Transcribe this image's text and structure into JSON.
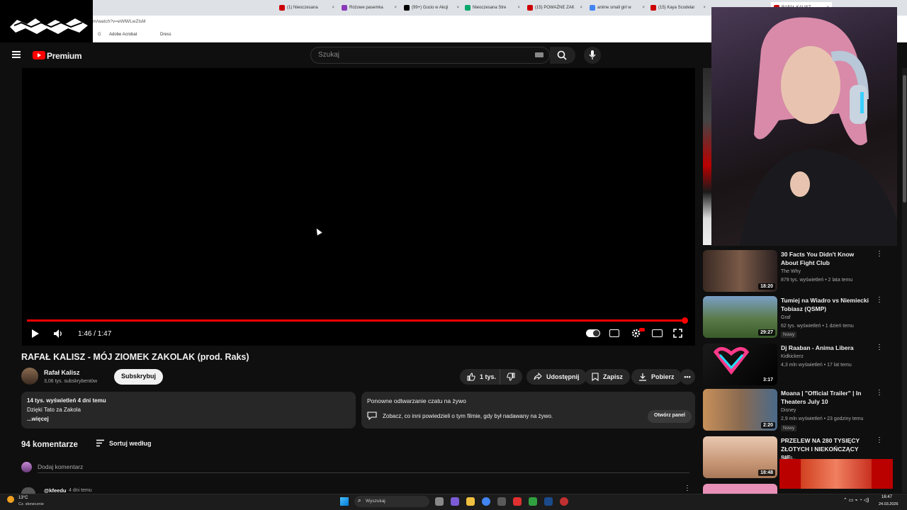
{
  "browser": {
    "tabs": [
      "(1) Nieoczesana",
      "Różowe pasemka",
      "(99+) Gucio w Akcji",
      "Nieoczesana Stre",
      "(15) POWAŻNE ZAK",
      "anime small girl w",
      "(15) Kaya Scodelar",
      "RAFAŁ KALISZ"
    ],
    "url": "m/watch?v=eWlWLwZlsM",
    "bookmarks": [
      "Adobe Acrobat",
      "Dress"
    ]
  },
  "header": {
    "brand": "Premium",
    "search_placeholder": "Szukaj"
  },
  "player": {
    "time": "1:46 / 1:47",
    "progress": 0.99
  },
  "video": {
    "title": "RAFAŁ KALISZ - MÓJ ZIOMEK ZAKOLAK (prod. Raks)",
    "channel": "Rafał Kalisz",
    "subs": "3,06 tys. subskrybentów",
    "subscribe": "Subskrybuj",
    "likes": "1 tys.",
    "share": "Udostępnij",
    "save": "Zapisz",
    "download": "Pobierz"
  },
  "description": {
    "views_date": "14 tys. wyświetleń  4 dni temu",
    "text": "Dzięki Tato za Zakola",
    "more": "...więcej"
  },
  "chat": {
    "title": "Ponowne odtwarzanie czatu na żywo",
    "text": "Zobacz, co inni powiedzieli o tym filmie, gdy był nadawany na żywo.",
    "button": "Otwórz panel"
  },
  "comments": {
    "count": "94 komentarze",
    "sort": "Sortuj według",
    "add": "Dodaj komentarz",
    "first_user": "@kfeedu",
    "first_time": "4 dni temu"
  },
  "recs": [
    {
      "title": "30 Facts You Didn't Know About Fight Club",
      "channel": "The Why",
      "meta": "879 tys. wyświetleń • 2 lata temu",
      "duration": "18:20",
      "new": ""
    },
    {
      "title": "Tumiej na Wiadro vs Niemiecki Tobiasz (QSMP)",
      "channel": "Graf",
      "meta": "62 tys. wyświetleń • 1 dzień temu",
      "duration": "29:27",
      "new": "Nowy"
    },
    {
      "title": "Dj Raaban - Anima Libera",
      "channel": "Kidkickerz",
      "meta": "4,3 mln wyświetleń • 17 lat temu",
      "duration": "3:17",
      "new": ""
    },
    {
      "title": "Moana | \"Official Trailer\" | In Theaters July 10",
      "channel": "Disney",
      "meta": "2,9 mln wyświetleń • 23 godziny temu",
      "duration": "2:20",
      "new": "Nowy"
    },
    {
      "title": "PRZELEW NA 280 TYSIĘCY ZŁOTYCH I NIEKOŃCZĄCY SIĘ...",
      "channel": "Baba",
      "meta": "",
      "duration": "18:48",
      "new": ""
    }
  ],
  "taskbar": {
    "weather": "13°C",
    "weather_desc": "Cz. słonecznie",
    "search": "Wyszukaj",
    "time": "16:47",
    "date": "24.03.2026"
  },
  "colors": {
    "accent": "#ff0000",
    "bg": "#0f0f0f",
    "card": "#272727"
  }
}
